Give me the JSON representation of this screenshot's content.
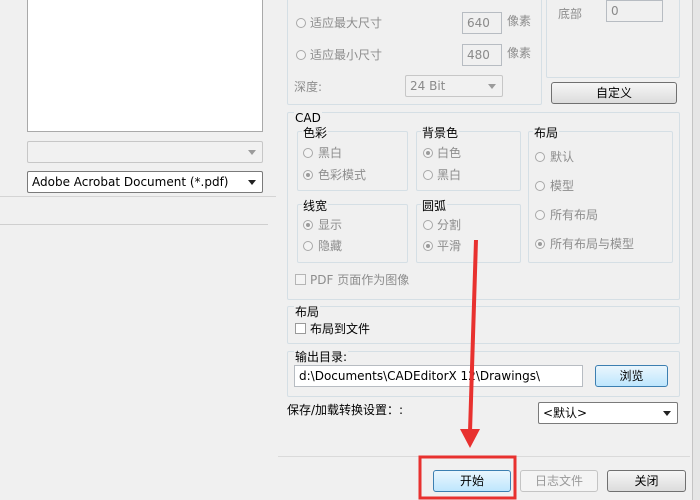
{
  "left": {
    "combo_empty": "",
    "format_combo": "Adobe Acrobat Document (*.pdf)"
  },
  "size": {
    "fit_max_label": "适应最大尺寸",
    "fit_max_value": "640",
    "fit_max_unit": "像素",
    "fit_min_label": "适应最小尺寸",
    "fit_min_value": "480",
    "fit_min_unit": "像素",
    "depth_label": "深度:",
    "depth_value": "24 Bit"
  },
  "margin": {
    "bottom_label": "底部",
    "bottom_value": "0",
    "custom_button": "自定义"
  },
  "cad": {
    "title": "CAD",
    "color": {
      "title": "色彩",
      "options": [
        "黑白",
        "色彩模式"
      ],
      "selected": "色彩模式"
    },
    "background": {
      "title": "背景色",
      "options": [
        "白色",
        "黑白"
      ],
      "selected": "白色"
    },
    "layout": {
      "title": "布局",
      "options": [
        "默认",
        "模型",
        "所有布局",
        "所有布局与模型"
      ],
      "selected": "所有布局与模型"
    },
    "lineweight": {
      "title": "线宽",
      "options": [
        "显示",
        "隐藏"
      ],
      "selected": "显示"
    },
    "arc": {
      "title": "圆弧",
      "options": [
        "分割",
        "平滑"
      ],
      "selected": "平滑"
    },
    "pdf_as_image": "PDF 页面作为图像"
  },
  "layout_section": {
    "title": "布局",
    "layout_to_file": "布局到文件"
  },
  "output": {
    "label": "输出目录:",
    "path": "d:\\Documents\\CADEditorX 12\\Drawings\\",
    "browse_button": "浏览"
  },
  "settings": {
    "label": "保存/加载转换设置：:",
    "value": "<默认>"
  },
  "footer": {
    "start_button": "开始",
    "log_button": "日志文件",
    "close_button": "关闭"
  },
  "colors": {
    "highlight": "#e8312f",
    "button_focus": "#3c7fb1"
  }
}
